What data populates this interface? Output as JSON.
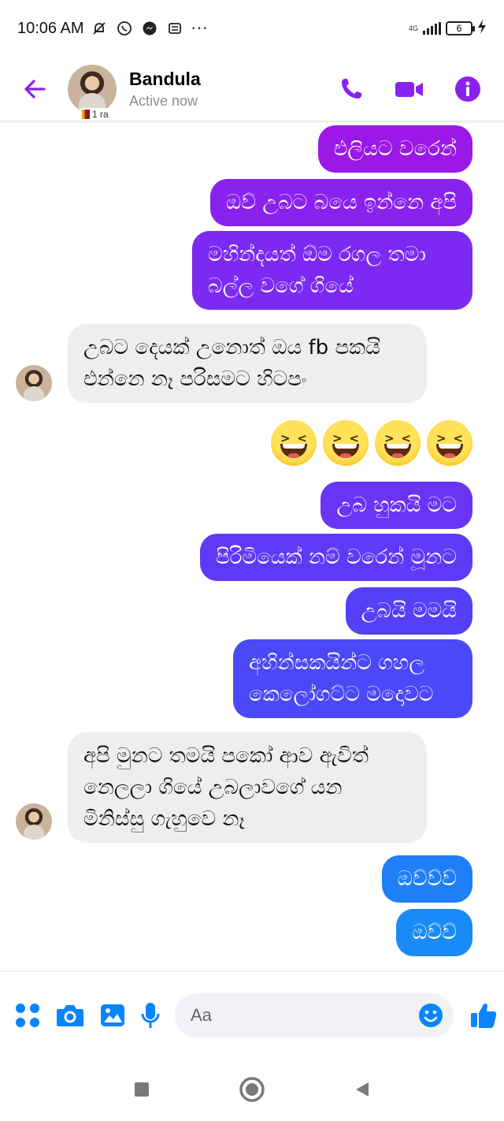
{
  "status_bar": {
    "time": "10:06 AM",
    "network": "4G",
    "battery": "6",
    "more": "···"
  },
  "header": {
    "contact_name": "Bandula",
    "contact_status": "Active now",
    "badge": "1 ra"
  },
  "messages": [
    {
      "dir": "out",
      "text": "එලියට වරෙන්",
      "color": "#9b18e6"
    },
    {
      "dir": "out",
      "text": "ඔව් උබට බයෙ ඉන්නෙ අපි",
      "color": "#8a22ee"
    },
    {
      "dir": "out",
      "text": "මහින්දයත් ඕම රගල තමා\nබල්ල වගේ ගියේ",
      "color": "#7c2af2"
    },
    {
      "dir": "in",
      "text": "උබට දෙයක් උනොත් ඔය fb පකයි\nඑන්නෙ නෑ පරිසමට හිටපං"
    },
    {
      "dir": "out",
      "type": "emoji",
      "text": "😆😆😆😆"
    },
    {
      "dir": "out",
      "text": "උබ හුකයි මට",
      "color": "#6a34f5"
    },
    {
      "dir": "out",
      "text": "පිරිමියෙක් නම් වරෙන් මූනට",
      "color": "#5f3af6"
    },
    {
      "dir": "out",
      "text": "උබයි මමයි",
      "color": "#5540f7"
    },
    {
      "dir": "out",
      "text": "අහින්සකයින්ට ගහල\nකෙලෝගට්ට මදොවට",
      "color": "#4b48f8"
    },
    {
      "dir": "in",
      "text": "අපි මුනට තමයි පකෝ ආව ඇවිත්\nනෙලලා ගියේ උබලාවගේ යන\nමිනිස්සු ගැහුවෙ නෑ"
    },
    {
      "dir": "out",
      "text": "ඔව්ව්ව්",
      "color": "#1f7ff7"
    },
    {
      "dir": "out",
      "text": "ඔව්ව්",
      "color": "#1a8bf6"
    }
  ],
  "composer": {
    "placeholder": "Aa"
  },
  "colors": {
    "brand": "#8a22ee",
    "received_bg": "#eeeeef",
    "composer_blue": "#0a84ff"
  }
}
